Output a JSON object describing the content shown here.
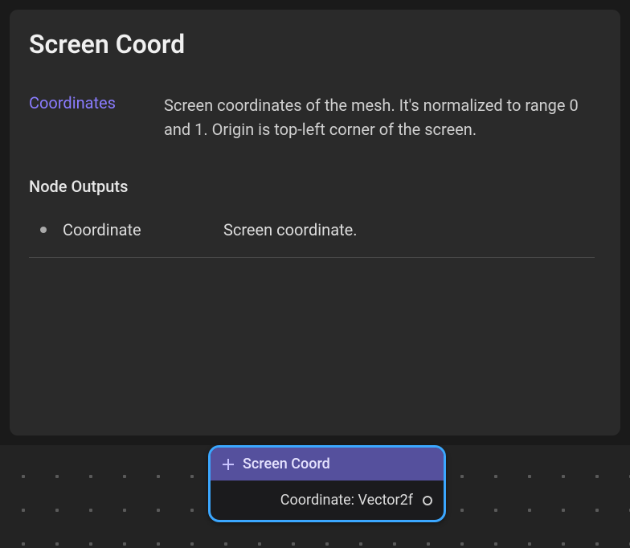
{
  "panel": {
    "title": "Screen Coord",
    "coordinates": {
      "label": "Coordinates",
      "description": "Screen coordinates of the mesh. It's normalized to range 0 and 1. Origin is top-left corner of the screen."
    },
    "outputs_heading": "Node Outputs",
    "outputs": [
      {
        "name": "Coordinate",
        "description": "Screen coordinate."
      }
    ]
  },
  "node": {
    "title": "Screen Coord",
    "output_label": "Coordinate: Vector2f"
  }
}
